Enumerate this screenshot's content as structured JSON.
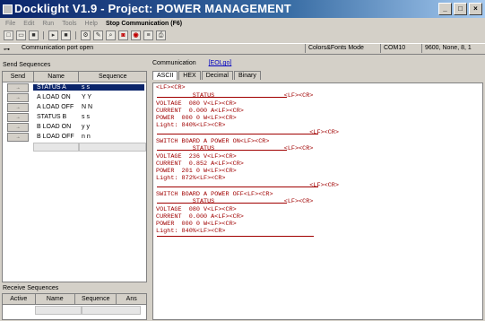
{
  "window": {
    "title": "Docklight V1.9 - Project: POWER MANAGEMENT",
    "buttons": {
      "minimize": "_",
      "maximize": "□",
      "close": "×"
    }
  },
  "menu": {
    "items": [
      "File",
      "Edit",
      "Run",
      "Tools",
      "Help"
    ],
    "stop_label": "Stop Communication  (F6)"
  },
  "statusbar": {
    "message": "Communication port open",
    "mode": "Colors&Fonts Mode",
    "port": "COM10",
    "settings": "9600, None, 8, 1"
  },
  "send": {
    "title": "Send Sequences",
    "columns": [
      "Send",
      "Name",
      "Sequence"
    ],
    "rows": [
      {
        "name": "STATUS A",
        "seq": "s s"
      },
      {
        "name": "A LOAD ON",
        "seq": "Y Y"
      },
      {
        "name": "A LOAD OFF",
        "seq": "N N"
      },
      {
        "name": "STATUS B",
        "seq": "s s"
      },
      {
        "name": "B LOAD ON",
        "seq": "y y"
      },
      {
        "name": "B LOAD OFF",
        "seq": "n n"
      }
    ]
  },
  "receive": {
    "title": "Receive Sequences",
    "columns": [
      "Active",
      "Name",
      "Sequence",
      "Ans"
    ]
  },
  "comm": {
    "label": "Communication",
    "link": "[EOLgo]"
  },
  "tabs": [
    "ASCII",
    "HEX",
    "Decimal",
    "Binary"
  ],
  "output": [
    "<LF><CR>",
    "          STATUS                   <LF><CR>",
    "VOLTAGE  080 V<LF><CR>",
    "CURRENT  0.000 A<LF><CR>",
    "POWER  000 0 W<LF><CR>",
    "Light: 840%<LF><CR>",
    "                                          <LF><CR>",
    "SWITCH BOARD A POWER ON<LF><CR>",
    "          STATUS                   <LF><CR>",
    "VOLTAGE  236 V<LF><CR>",
    "CURRENT  0.852 A<LF><CR>",
    "POWER  201 0 W<LF><CR>",
    "Light: 872%<LF><CR>",
    "                                          <LF><CR>",
    "SWITCH BOARD A POWER OFF<LF><CR>",
    "          STATUS                   <LF><CR>",
    "VOLTAGE  080 V<LF><CR>",
    "CURRENT  0.000 A<LF><CR>",
    "POWER  000 0 W<LF><CR>",
    "Light: 840%<LF><CR>"
  ]
}
